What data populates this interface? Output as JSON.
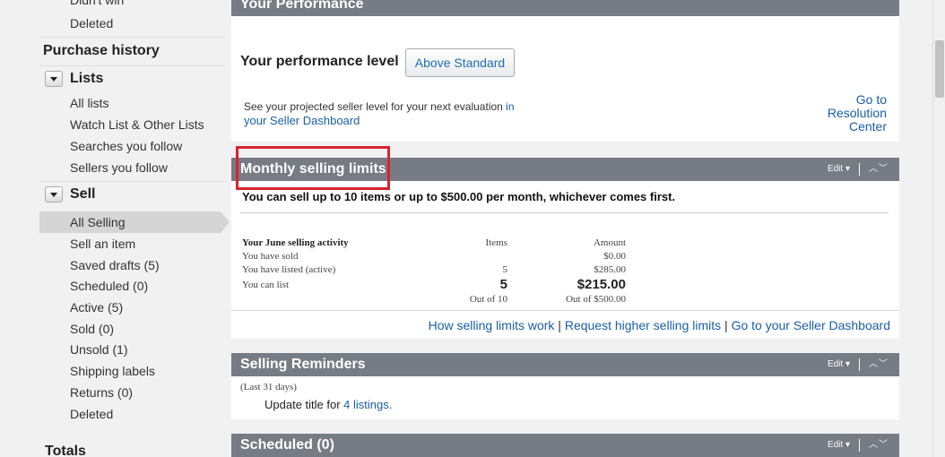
{
  "sidebar": {
    "partial_item": "Didn't win",
    "deleted_top": "Deleted",
    "purchase_history": "Purchase history",
    "lists_heading": "Lists",
    "lists_items": [
      "All lists",
      "Watch List & Other Lists",
      "Searches you follow",
      "Sellers you follow"
    ],
    "sell_heading": "Sell",
    "sell_items": [
      "All Selling",
      "Sell an item",
      "Saved drafts (5)",
      "Scheduled (0)",
      "Active (5)",
      "Sold (0)",
      "Unsold (1)",
      "Shipping labels",
      "Returns (0)",
      "Deleted"
    ],
    "totals": "Totals"
  },
  "performance": {
    "header": "Your Performance",
    "level_label": "Your performance level",
    "level_value": "Above Standard",
    "projected_text": "See your projected seller level for your next evaluation ",
    "projected_link_1": "in",
    "projected_link_2": "your Seller Dashboard",
    "resolution_1": "Go to",
    "resolution_2": "Resolution",
    "resolution_3": "Center"
  },
  "monthly": {
    "header": "Monthly selling limits",
    "edit": "Edit",
    "summary": "You can sell up to 10 items or up to $500.00 per month, whichever comes first.",
    "activity_title": "Your June selling activity",
    "col_items": "Items",
    "col_amount": "Amount",
    "rows": [
      {
        "label": "You have sold",
        "items": "",
        "amount": "$0.00"
      },
      {
        "label": "You have listed (active)",
        "items": "5",
        "amount": "$285.00"
      },
      {
        "label": "You can list",
        "items": "5",
        "amount": "$215.00"
      }
    ],
    "out_of_items": "Out of 10",
    "out_of_amount": "Out of $500.00",
    "link_how": "How selling limits work",
    "link_request": "Request higher selling limits",
    "link_dashboard": "Go to your Seller Dashboard"
  },
  "reminders": {
    "header": "Selling Reminders",
    "edit": "Edit",
    "period": "(Last 31 days)",
    "update_text": "Update title for ",
    "update_link": "4 listings."
  },
  "scheduled": {
    "header": "Scheduled (0)",
    "edit": "Edit"
  },
  "colors": {
    "panel_header": "#767b84",
    "link": "#1a5fa8",
    "highlight": "#d92231"
  }
}
